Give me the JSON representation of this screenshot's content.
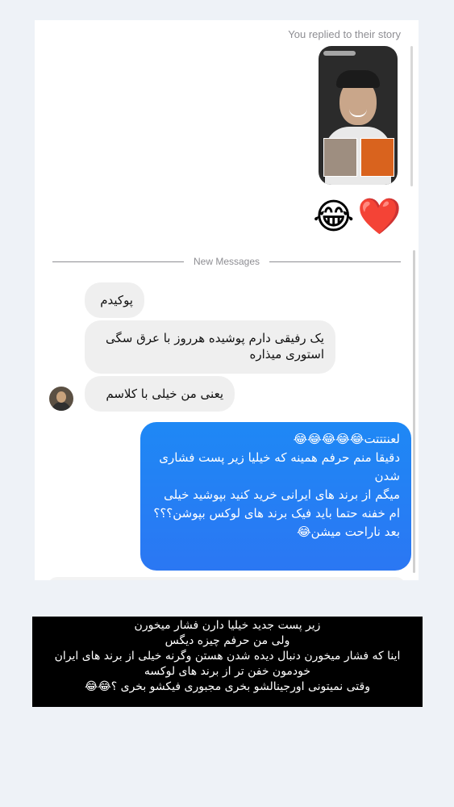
{
  "story": {
    "caption": "You replied to their story",
    "reactions": "😂❤️"
  },
  "divider": {
    "label": "New Messages"
  },
  "incoming": [
    "پوکیدم",
    "یک رفیقی دارم پوشیده هرروز با عرق سگی استوری میذاره",
    "یعنی من خیلی با کلاسم"
  ],
  "outgoing": {
    "lines": [
      "لعنتتتت😂😂😂😂😂",
      "دقیقا منم حرفم همینه که خیلیا زیر پست فشاری شدن",
      "میگم از برند های ایرانی خرید کنید بپوشید خیلی ام خفنه حتما باید فیک برند های لوکس بپوشن؟؟؟",
      "بعد ناراحت میشن😂"
    ]
  },
  "overlay": {
    "lines": [
      "زیر پست جدید خیلیا دارن فشار میخورن",
      "ولی من حرفم چیزه دیگس",
      "اینا که فشار میخورن دنبال دیده شدن هستن وگرنه خیلی از برند های ایران خودمون خفن تر از برند های لوکسه",
      "وقتی نمیتونی اورجینالشو بخری مجبوری فیکشو بخری ؟😂😂"
    ]
  }
}
